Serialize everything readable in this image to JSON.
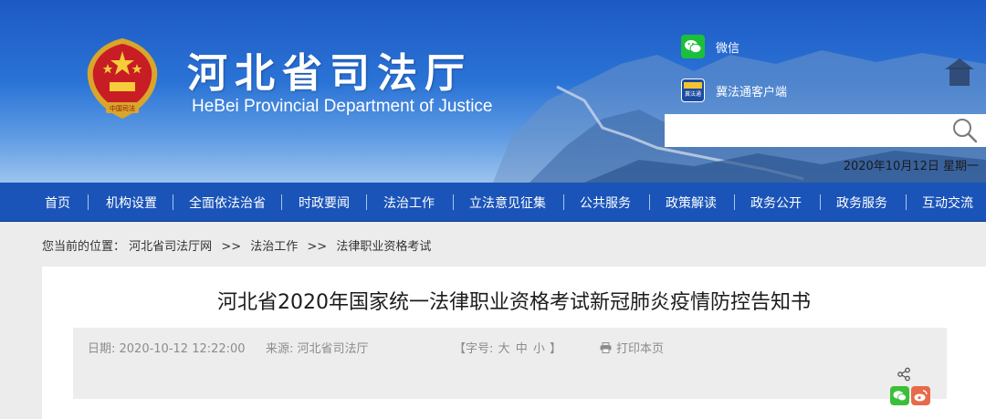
{
  "header": {
    "title": "河北省司法厅",
    "subtitle": "HeBei Provincial Department of Justice",
    "emblem_text": "中国司法",
    "wechat_label": "微信",
    "jifatong_label": "冀法通客户端",
    "jifatong_icon_text": "冀法通",
    "search": {
      "value": "",
      "placeholder": ""
    },
    "date": "2020年10月12日 星期一"
  },
  "nav": {
    "items": [
      {
        "label": "首页"
      },
      {
        "label": "机构设置"
      },
      {
        "label": "全面依法治省"
      },
      {
        "label": "时政要闻"
      },
      {
        "label": "法治工作"
      },
      {
        "label": "立法意见征集"
      },
      {
        "label": "公共服务"
      },
      {
        "label": "政策解读"
      },
      {
        "label": "政务公开"
      },
      {
        "label": "政务服务"
      },
      {
        "label": "互动交流"
      }
    ]
  },
  "breadcrumb": {
    "prefix": "您当前的位置：",
    "items": [
      "河北省司法厅网",
      "法治工作",
      "法律职业资格考试"
    ],
    "separator": ">>"
  },
  "article": {
    "title": "河北省2020年国家统一法律职业资格考试新冠肺炎疫情防控告知书",
    "date": "日期: 2020-10-12 12:22:00",
    "source": "来源: 河北省司法厅",
    "font_size_prefix": "【字号:",
    "font_large": "大",
    "font_medium": "中",
    "font_small": "小",
    "font_size_suffix": "】",
    "print_label": "打印本页"
  },
  "colors": {
    "nav_bg": "#1a54b8",
    "banner_top": "#1d59c4",
    "wechat_green": "#1cbf3c",
    "weibo_red": "#e86a4b"
  }
}
